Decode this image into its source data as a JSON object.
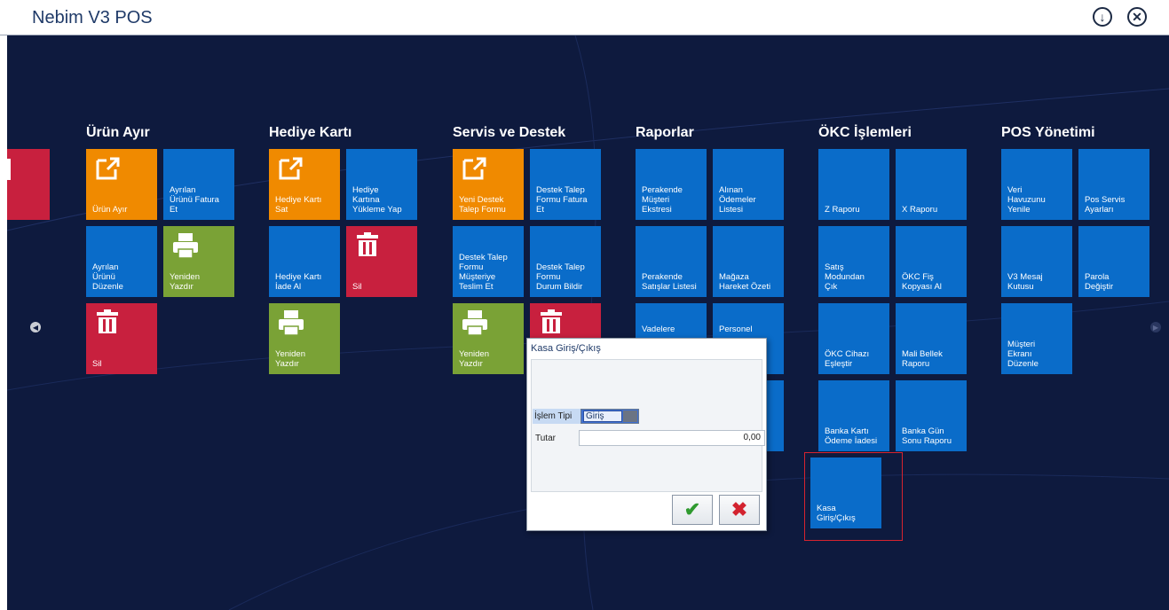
{
  "app": {
    "title": "Nebim V3 POS"
  },
  "window_controls": {
    "download_glyph": "↓",
    "close_glyph": "✕"
  },
  "colors": {
    "tile_blue": "#0a6cc9",
    "tile_orange": "#f08a00",
    "tile_green": "#7aa236",
    "tile_red": "#c8203e",
    "background": "#0e1a3e"
  },
  "groups": {
    "urun_ayir": {
      "title": "Ürün Ayır",
      "tiles": [
        "Ürün Ayır",
        "Ayrılan\nÜrünü Fatura\nEt",
        "Ayrılan\nÜrünü\nDüzenle",
        "Yeniden\nYazdır",
        "Sil"
      ]
    },
    "hediye_karti": {
      "title": "Hediye Kartı",
      "tiles": [
        "Hediye Kartı\nSat",
        "Hediye\nKartına\nYükleme Yap",
        "Hediye Kartı\nİade Al",
        "Sil",
        "Yeniden\nYazdır"
      ]
    },
    "servis": {
      "title": "Servis ve Destek",
      "tiles": [
        "Yeni Destek\nTalep Formu",
        "Destek Talep\nFormu Fatura\nEt",
        "Destek Talep\nFormu\nMüşteriye\nTeslim Et",
        "Destek Talep\nFormu\nDurum Bildir",
        "Yeniden\nYazdır"
      ]
    },
    "raporlar": {
      "title": "Raporlar",
      "tiles": [
        "Perakende\nMüşteri\nEkstresi",
        "Alınan\nÖdemeler\nListesi",
        "Perakende\nSatışlar Listesi",
        "Mağaza\nHareket Özeti",
        "Vadelere",
        "Personel"
      ]
    },
    "okc": {
      "title": "ÖKC İşlemleri",
      "tiles": [
        "Z Raporu",
        "X Raporu",
        "Satış\nModundan\nÇık",
        "ÖKC Fiş\nKopyası Al",
        "ÖKC Cihazı\nEşleştir",
        "Mali Bellek\nRaporu",
        "Banka Kartı\nÖdeme İadesi",
        "Banka Gün\nSonu Raporu",
        "Kasa\nGiriş/Çıkış"
      ]
    },
    "pos": {
      "title": "POS Yönetimi",
      "tiles": [
        "Veri\nHavuzunu\nYenile",
        "Pos Servis\nAyarları",
        "V3 Mesaj\nKutusu",
        "Parola\nDeğiştir",
        "Müşteri\nEkranı\nDüzenle"
      ]
    }
  },
  "dialog": {
    "title": "Kasa Giriş/Çıkış",
    "islem_tipi_label": "İşlem Tipi",
    "islem_tipi_value": "Giriş",
    "tutar_label": "Tutar",
    "tutar_value": "0,00",
    "ok_glyph": "✔",
    "cancel_glyph": "✖"
  }
}
